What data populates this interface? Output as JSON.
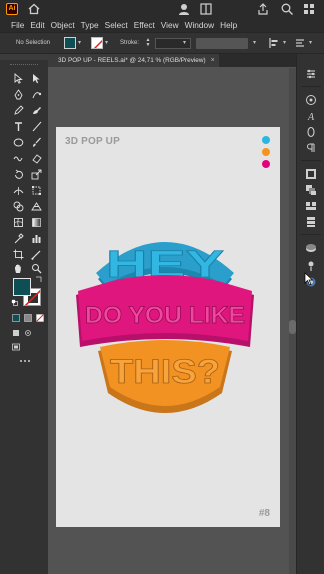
{
  "app": {
    "logo_text": "Ai",
    "menu": [
      "File",
      "Edit",
      "Object",
      "Type",
      "Select",
      "Effect",
      "View",
      "Window",
      "Help"
    ]
  },
  "control_bar": {
    "selection_label": "No Selection",
    "stroke_label": "Stroke:",
    "fill_color": "#0d4f55"
  },
  "document": {
    "tab_title": "3D POP UP - REELS.ai* @ 24,71 % (RGB/Preview)",
    "close_symbol": "×"
  },
  "artboard": {
    "title": "3D POP UP",
    "number": "#8",
    "dots": [
      {
        "color": "#29b6e3"
      },
      {
        "color": "#f7941d"
      },
      {
        "color": "#e5007e"
      }
    ],
    "words": [
      "HEY",
      "DO YOU LIKE",
      "THIS?"
    ],
    "word_colors": {
      "top": "#31b7e2",
      "middle": "#e0167f",
      "bottom": "#f29223"
    }
  },
  "colors": {
    "bg_dark": "#2b2b2b",
    "panel": "#323232",
    "canvas": "#535353",
    "artboard": "#e4e4e4",
    "accent_blue": "#31b7e2",
    "accent_pink": "#e0167f",
    "accent_orange": "#f29223"
  }
}
